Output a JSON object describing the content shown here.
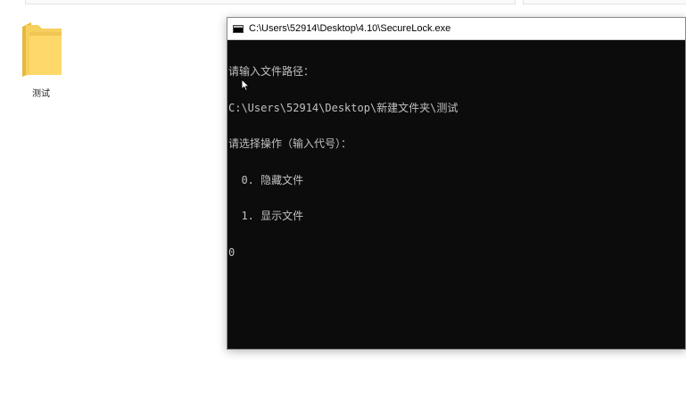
{
  "desktop": {
    "folder": {
      "label": "测试",
      "icon": "folder-icon"
    }
  },
  "console": {
    "title": "C:\\Users\\52914\\Desktop\\4.10\\SecureLock.exe",
    "icon": "console-window-icon",
    "lines": [
      "请输入文件路径：",
      "C:\\Users\\52914\\Desktop\\新建文件夹\\测试",
      "请选择操作（输入代号）：",
      "  0. 隐藏文件",
      "  1. 显示文件",
      "0"
    ],
    "colors": {
      "background": "#0c0c0c",
      "text": "#c0c0c0"
    }
  }
}
